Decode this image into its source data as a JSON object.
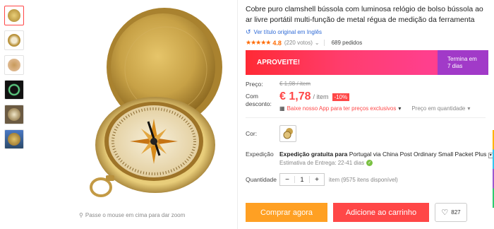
{
  "gallery": {
    "thumbnails": [
      "compass-closed",
      "compass-open",
      "compass-in-hand",
      "compass-glow",
      "compass-outdoor",
      "compass-landscape"
    ],
    "zoom_hint": "Passe o mouse em cima para dar zoom"
  },
  "product": {
    "title": "Cobre puro clamshell bússola com luminosa relógio de bolso bússola ao ar livre portátil multi-função de metal régua de medição da ferramenta",
    "translate_link": "Ver título original em Inglês",
    "rating_value": "4.8",
    "votes": "(220 votos)",
    "orders": "689 pedidos"
  },
  "promo": {
    "label": "APROVEITE!",
    "ends_label": "Termina em",
    "ends_value": "7 dias"
  },
  "pricing": {
    "price_label": "Preço:",
    "old_price": "€ 1,98 / item",
    "discount_label": "Com desconto:",
    "price": "€ 1,78",
    "unit": "/ item",
    "discount": "-10%",
    "app_offer": "Baixe nosso App para ter preços exclusivos",
    "bulk": "Preço em quantidade"
  },
  "options": {
    "color_label": "Cor:",
    "shipping_label": "Expedição",
    "shipping_free": "Expedição gratuita para",
    "shipping_dest": "Portugal via China Post Ordinary Small Packet Plus",
    "delivery_estimate": "Estimativa de Entrega: 22-41 dias",
    "quantity_label": "Quantidade",
    "quantity_value": "1",
    "quantity_info": "item (9575 itens disponível)"
  },
  "actions": {
    "buy": "Comprar agora",
    "cart": "Adicione ao carrinho",
    "wishlist_count": "827"
  },
  "colors": {
    "accent": "#ff4747",
    "buy": "#ffa023",
    "promo_end": "#a13ac8",
    "link": "#2e6ad6"
  }
}
